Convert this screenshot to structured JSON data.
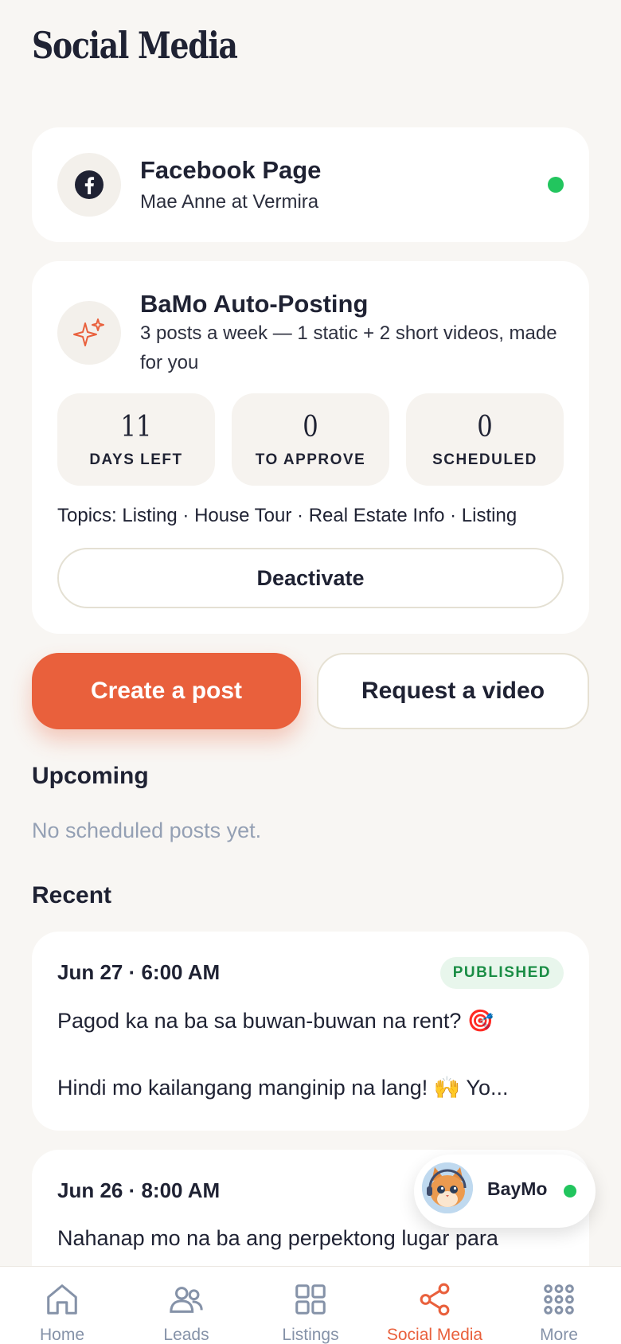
{
  "page": {
    "title": "Social Media"
  },
  "facebook": {
    "title": "Facebook Page",
    "page_name": "Mae Anne at Vermira",
    "connected_color": "#22c55e",
    "icon": "facebook-icon"
  },
  "auto_posting": {
    "title": "BaMo Auto-Posting",
    "description": "3 posts a week — 1 static + 2 short videos, made for you",
    "icon": "sparkles-icon",
    "stats": [
      {
        "value": "11",
        "label": "DAYS LEFT"
      },
      {
        "value": "0",
        "label": "TO APPROVE"
      },
      {
        "value": "0",
        "label": "SCHEDULED"
      }
    ],
    "topics": "Topics: Listing · House Tour · Real Estate Info · Listing",
    "deactivate_label": "Deactivate"
  },
  "actions": {
    "create_label": "Create a post",
    "request_label": "Request a video"
  },
  "upcoming": {
    "heading": "Upcoming",
    "empty_text": "No scheduled posts yet."
  },
  "recent": {
    "heading": "Recent",
    "posts": [
      {
        "date": "Jun 27 · 6:00 AM",
        "status": "PUBLISHED",
        "line1": "Pagod ka na ba sa buwan-buwan na rent? 🎯",
        "line2": "Hindi mo kailangang manginip na lang! 🙌  Yo..."
      },
      {
        "date": "Jun 26 · 8:00 AM",
        "line1": "Nahanap mo na ba ang perpektong lugar para"
      }
    ]
  },
  "assistant": {
    "name": "BayMo",
    "online_color": "#22c55e"
  },
  "tabbar": {
    "items": [
      {
        "label": "Home",
        "icon": "home-icon"
      },
      {
        "label": "Leads",
        "icon": "users-icon"
      },
      {
        "label": "Listings",
        "icon": "grid-icon"
      },
      {
        "label": "Social Media",
        "icon": "share-icon",
        "active": true
      },
      {
        "label": "More",
        "icon": "dots-grid-icon"
      }
    ]
  },
  "colors": {
    "accent": "#e9603c",
    "background": "#f8f6f3",
    "published_badge": "#1a8d45"
  }
}
